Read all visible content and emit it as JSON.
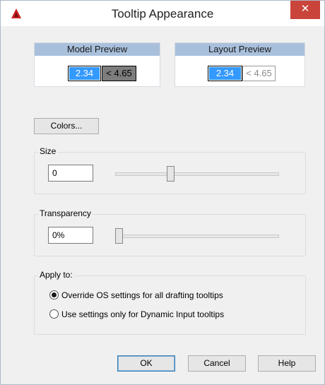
{
  "window": {
    "title": "Tooltip Appearance",
    "close_glyph": "✕"
  },
  "model_preview": {
    "heading": "Model Preview",
    "value1": "2.34",
    "value2": "< 4.65"
  },
  "layout_preview": {
    "heading": "Layout Preview",
    "value1": "2.34",
    "value2": "< 4.65"
  },
  "colors_button": {
    "label": "Colors..."
  },
  "size": {
    "label": "Size",
    "value": "0",
    "slider_fraction": 0.33
  },
  "transparency": {
    "label": "Transparency",
    "value": "0%",
    "slider_fraction": 0.0
  },
  "apply_to": {
    "label": "Apply to:",
    "options": [
      {
        "label": "Override OS settings for all drafting tooltips",
        "selected": true
      },
      {
        "label": "Use settings only for Dynamic Input tooltips",
        "selected": false
      }
    ]
  },
  "buttons": {
    "ok": "OK",
    "cancel": "Cancel",
    "help": "Help"
  },
  "colors": {
    "accent": "#3399ff",
    "close": "#c9443a",
    "preview_header": "#a9c0dc",
    "app_icon": "#cc2222"
  }
}
